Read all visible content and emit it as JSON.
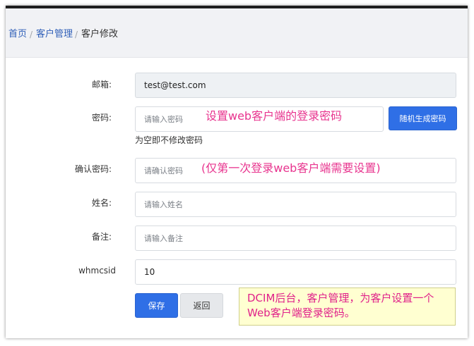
{
  "breadcrumb": {
    "home": "首页",
    "customer_management": "客户管理",
    "current": "客户修改",
    "separator": "/"
  },
  "form": {
    "email": {
      "label": "邮箱:",
      "value": "test@test.com"
    },
    "password": {
      "label": "密码:",
      "placeholder": "请输入密码",
      "generate_button": "随机生成密码",
      "helper": "为空即不修改密码"
    },
    "confirm_password": {
      "label": "确认密码:",
      "placeholder": "请确认密码"
    },
    "name": {
      "label": "姓名:",
      "placeholder": "请输入姓名"
    },
    "remark": {
      "label": "备注:",
      "placeholder": "请输入备注"
    },
    "whmcsid": {
      "label": "whmcsid",
      "value": "10"
    },
    "save_button": "保存",
    "back_button": "返回"
  },
  "annotations": {
    "password_note": "设置web客户端的登录密码",
    "confirm_note": "(仅第一次登录web客户端需要设置)",
    "callout_line1": "DCIM后台，客户管理，为客户设置一个",
    "callout_line2": "Web客户端登录密码。"
  },
  "colors": {
    "primary": "#2f6fe6",
    "annotation_pink": "#e8358f",
    "callout_bg": "#ffffd1",
    "link": "#2f5fb8"
  }
}
